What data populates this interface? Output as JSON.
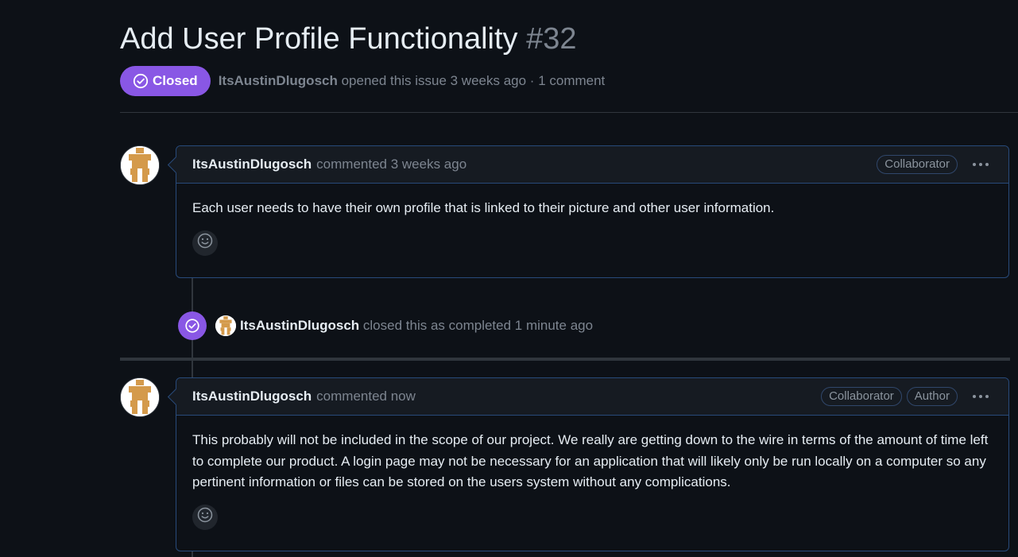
{
  "issue": {
    "title": "Add User Profile Functionality",
    "number": "#32",
    "state_label": "Closed",
    "author": "ItsAustinDlugosch",
    "meta_text": "opened this issue 3 weeks ago · 1 comment"
  },
  "colors": {
    "closed_badge": "#8957e5",
    "comment_border": "#284a7a",
    "background": "#0d1117"
  },
  "comments": [
    {
      "author": "ItsAustinDlugosch",
      "time": "commented 3 weeks ago",
      "labels": [
        "Collaborator"
      ],
      "body": "Each user needs to have their own profile that is linked to their picture and other user information.",
      "menu_icon": "kebab-horizontal-icon",
      "reaction_icon": "smiley-icon"
    },
    {
      "author": "ItsAustinDlugosch",
      "time": "commented now",
      "labels": [
        "Collaborator",
        "Author"
      ],
      "body": "This probably will not be included in the scope of our project. We really are getting down to the wire in terms of the amount of time left to complete our product. A login page may not be necessary for an application that will likely only be run locally on a computer so any pertinent information or files can be stored on the users system without any complications.",
      "menu_icon": "kebab-horizontal-icon",
      "reaction_icon": "smiley-icon"
    }
  ],
  "event": {
    "icon": "check-circle-icon",
    "author": "ItsAustinDlugosch",
    "text": "closed this as completed 1 minute ago"
  }
}
